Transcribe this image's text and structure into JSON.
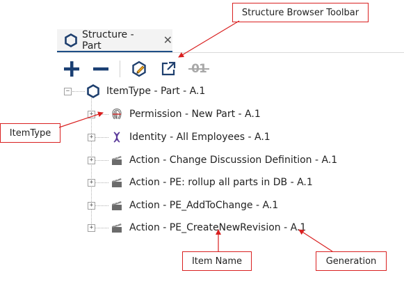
{
  "tab": {
    "label": "Structure - Part",
    "close": "✕"
  },
  "toolbar": {
    "buttons": [
      {
        "name": "add-icon"
      },
      {
        "name": "remove-icon"
      },
      {
        "name": "edit-icon"
      },
      {
        "name": "open-external-icon"
      },
      {
        "name": "generation-icon"
      }
    ],
    "generation_label": "01"
  },
  "tree": {
    "root": {
      "label": "ItemType - Part - A.1",
      "icon": "itemtype-icon",
      "expander": "−"
    },
    "children": [
      {
        "label": "Permission - New Part - A.1",
        "icon": "permission-icon",
        "expander": "+"
      },
      {
        "label": "Identity - All Employees - A.1",
        "icon": "identity-icon",
        "expander": "+"
      },
      {
        "label": "Action - Change Discussion Definition - A.1",
        "icon": "action-icon",
        "expander": "+"
      },
      {
        "label": "Action - PE: rollup all parts in DB - A.1",
        "icon": "action-icon",
        "expander": "+"
      },
      {
        "label": "Action - PE_AddToChange - A.1",
        "icon": "action-icon",
        "expander": "+"
      },
      {
        "label": "Action - PE_CreateNewRevision - A.1",
        "icon": "action-icon",
        "expander": "+"
      }
    ]
  },
  "callouts": {
    "toolbar": "Structure Browser Toolbar",
    "itemtype": "ItemType",
    "item_name": "Item Name",
    "generation": "Generation"
  },
  "colors": {
    "accent": "#1e4f86",
    "callout_border": "#d92020",
    "add_icon": "#1a3f73"
  }
}
